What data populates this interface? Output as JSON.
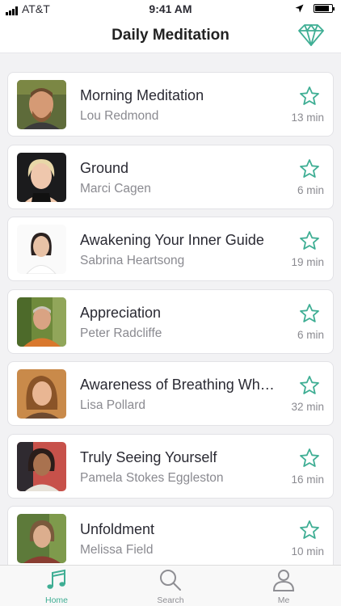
{
  "status_bar": {
    "carrier": "AT&T",
    "time": "9:41 AM",
    "battery_level": 0.85
  },
  "header": {
    "title": "Daily Meditation",
    "premium_icon": "diamond-icon"
  },
  "colors": {
    "accent": "#3fae94",
    "text": "#2b2b33",
    "muted": "#8a8a90",
    "background": "#f2f2f4"
  },
  "meditations": [
    {
      "title": "Morning Meditation",
      "teacher": "Lou Redmond",
      "duration": "13 min",
      "favorite_icon": "star-outline-icon"
    },
    {
      "title": "Ground",
      "teacher": "Marci Cagen",
      "duration": "6 min",
      "favorite_icon": "star-outline-icon"
    },
    {
      "title": "Awakening Your Inner Guide",
      "teacher": "Sabrina Heartsong",
      "duration": "19 min",
      "favorite_icon": "star-outline-icon"
    },
    {
      "title": "Appreciation",
      "teacher": "Peter Radcliffe",
      "duration": "6 min",
      "favorite_icon": "star-outline-icon"
    },
    {
      "title": "Awareness of Breathing Wh…",
      "teacher": "Lisa Pollard",
      "duration": "32 min",
      "favorite_icon": "star-outline-icon"
    },
    {
      "title": "Truly Seeing Yourself",
      "teacher": "Pamela Stokes Eggleston",
      "duration": "16 min",
      "favorite_icon": "star-outline-icon"
    },
    {
      "title": "Unfoldment",
      "teacher": "Melissa Field",
      "duration": "10 min",
      "favorite_icon": "star-outline-icon"
    }
  ],
  "tab_bar": {
    "tabs": [
      {
        "label": "Home",
        "icon": "music-note-icon",
        "active": true
      },
      {
        "label": "Search",
        "icon": "search-icon",
        "active": false
      },
      {
        "label": "Me",
        "icon": "person-icon",
        "active": false
      }
    ]
  }
}
